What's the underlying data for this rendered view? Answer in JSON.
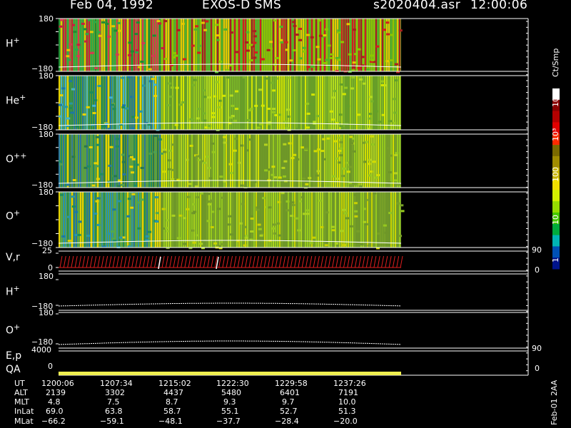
{
  "header": {
    "date": "Feb 04, 1992",
    "instrument": "EXOS-D SMS",
    "file": "s2020404.asr",
    "time": "12:00:06"
  },
  "panels": [
    {
      "label": "H",
      "sup": "+",
      "top": "180",
      "bottom": "−180"
    },
    {
      "label": "He",
      "sup": "+",
      "top": "180",
      "bottom": "−180"
    },
    {
      "label": "O",
      "sup": "++",
      "top": "180",
      "bottom": "−180"
    },
    {
      "label": "O",
      "sup": "+",
      "top": "180",
      "bottom": "−180"
    }
  ],
  "vr": {
    "label": "V,r",
    "top": "25",
    "bottom": "0",
    "right_top": "90",
    "right_bottom": "0"
  },
  "line_panels": [
    {
      "label": "H",
      "sup": "+",
      "top": "180",
      "bottom": "−180"
    },
    {
      "label": "O",
      "sup": "+",
      "top": "180",
      "bottom": "−180"
    }
  ],
  "ep": {
    "label": "E,p",
    "value": "4000",
    "right": "90"
  },
  "qa": {
    "label": "QA",
    "value": "0",
    "right": "0"
  },
  "colorbar": {
    "unit": "Ct/Smp",
    "ticks": [
      "10⁴",
      "10³",
      "100",
      "10",
      "1"
    ],
    "colors": [
      "#ffffff",
      "#8a0000",
      "#b40000",
      "#e00000",
      "#ff2a00",
      "#7a6a00",
      "#a08c00",
      "#c8b400",
      "#f0e000",
      "#d2f000",
      "#96dc00",
      "#46c800",
      "#00aa3c",
      "#00b4b4",
      "#0050b4",
      "#00148c"
    ]
  },
  "footer_note": "Feb-01 2AA",
  "table": {
    "headers": [
      "UT",
      "ALT",
      "MLT",
      "InLat",
      "MLat"
    ],
    "columns": [
      [
        "1200:06",
        "2139",
        "4.8",
        "69.0",
        "−66.2"
      ],
      [
        "1207:34",
        "3302",
        "7.5",
        "63.8",
        "−59.1"
      ],
      [
        "1215:02",
        "4437",
        "8.7",
        "58.7",
        "−48.1"
      ],
      [
        "1222:30",
        "5480",
        "9.3",
        "55.1",
        "−37.7"
      ],
      [
        "1229:58",
        "6401",
        "9.7",
        "52.7",
        "−28.4"
      ],
      [
        "1237:26",
        "7191",
        "10.0",
        "51.3",
        "−20.0"
      ]
    ]
  }
}
